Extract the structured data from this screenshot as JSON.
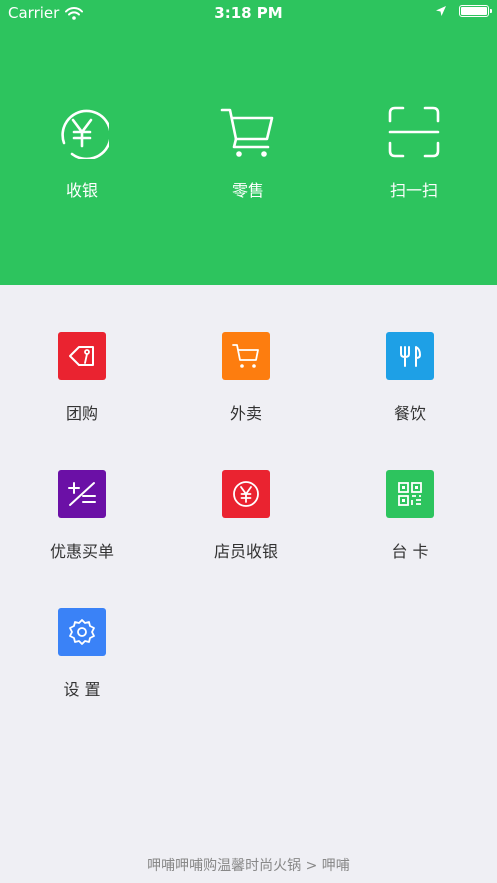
{
  "status_bar": {
    "carrier": "Carrier",
    "time": "3:18 PM"
  },
  "top_actions": [
    {
      "label": "收银",
      "icon": "yen-icon"
    },
    {
      "label": "零售",
      "icon": "cart-icon"
    },
    {
      "label": "扫一扫",
      "icon": "scan-icon"
    }
  ],
  "grid": [
    {
      "label": "团购",
      "icon": "tag-icon",
      "color": "#ea2330"
    },
    {
      "label": "外卖",
      "icon": "cart-icon",
      "color": "#fd7d0f"
    },
    {
      "label": "餐饮",
      "icon": "fork-knife-icon",
      "color": "#1ea0e6"
    },
    {
      "label": "优惠买单",
      "icon": "plus-minus-icon",
      "color": "#6b10a6"
    },
    {
      "label": "店员收银",
      "icon": "yen-icon",
      "color": "#ea2330"
    },
    {
      "label": "台 卡",
      "icon": "qr-code-icon",
      "color": "#2dc45e"
    },
    {
      "label": "设 置",
      "icon": "gear-icon",
      "color": "#3a82f7"
    }
  ],
  "footer": {
    "text": "呷哺呷哺购温馨时尚火锅 > 呷哺"
  }
}
